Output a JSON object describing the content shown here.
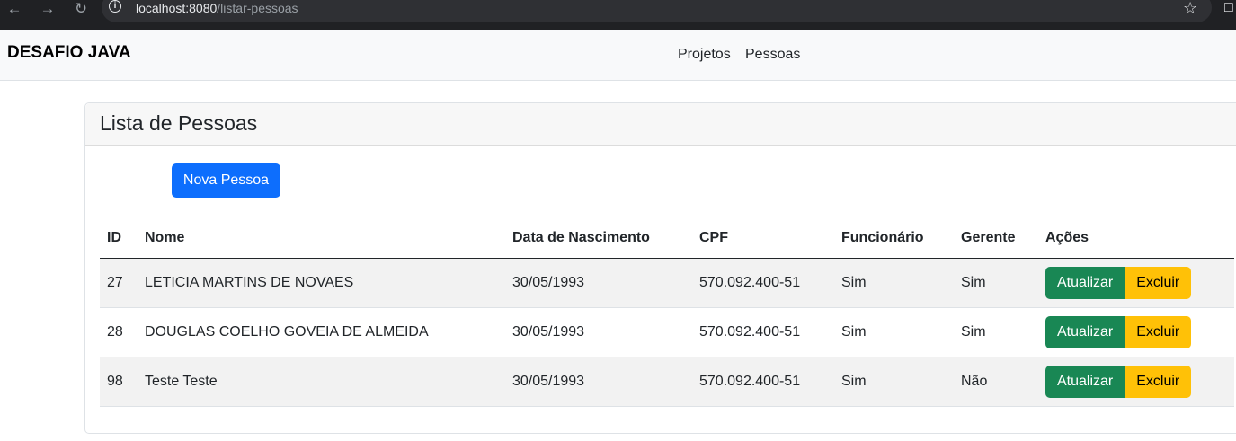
{
  "browser": {
    "url_host": "localhost:8080",
    "url_path": "/listar-pessoas",
    "icons": [
      "back-icon",
      "forward-icon",
      "reload-icon",
      "info-icon",
      "star-icon",
      "extensions-icon"
    ]
  },
  "navbar": {
    "brand": "DESAFIO JAVA",
    "links": [
      "Projetos",
      "Pessoas"
    ]
  },
  "card": {
    "title": "Lista de Pessoas",
    "new_button": "Nova Pessoa"
  },
  "table": {
    "headers": [
      "ID",
      "Nome",
      "Data de Nascimento",
      "CPF",
      "Funcionário",
      "Gerente",
      "Ações"
    ],
    "rows": [
      {
        "id": "27",
        "nome": "LETICIA MARTINS DE NOVAES",
        "nascimento": "30/05/1993",
        "cpf": "570.092.400-51",
        "funcionario": "Sim",
        "gerente": "Sim"
      },
      {
        "id": "28",
        "nome": "DOUGLAS COELHO GOVEIA DE ALMEIDA",
        "nascimento": "30/05/1993",
        "cpf": "570.092.400-51",
        "funcionario": "Sim",
        "gerente": "Sim"
      },
      {
        "id": "98",
        "nome": "Teste Teste",
        "nascimento": "30/05/1993",
        "cpf": "570.092.400-51",
        "funcionario": "Sim",
        "gerente": "Não"
      }
    ],
    "update_label": "Atualizar",
    "delete_label": "Excluir"
  },
  "colors": {
    "primary": "#0d6efd",
    "success": "#198754",
    "warning": "#ffc107",
    "browser_bar": "#202124"
  }
}
